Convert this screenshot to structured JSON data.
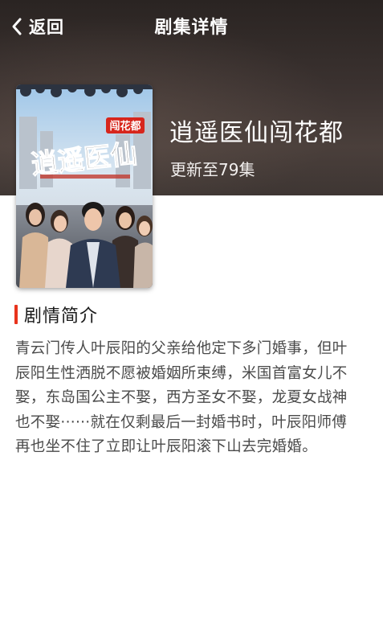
{
  "nav": {
    "back_label": "返回",
    "title": "剧集详情"
  },
  "drama": {
    "title": "逍遥医仙闯花都",
    "episode_status": "更新至79集",
    "poster_badge": "闯花都",
    "poster_calligraphy": "逍遥医仙"
  },
  "synopsis": {
    "header": "剧情简介",
    "text": "青云门传人叶辰阳的父亲给他定下多门婚事，但叶辰阳生性洒脱不愿被婚姻所束缚，米国首富女儿不娶，东岛国公主不娶，西方圣女不娶，龙夏女战神也不娶······就在仅剩最后一封婚书时，叶辰阳师傅再也坐不住了立即让叶辰阳滚下山去完婚婚。"
  },
  "colors": {
    "accent": "#e8331c",
    "hero_background": "#3b3230",
    "body_text": "#4a4a4a"
  },
  "icons": {
    "back": "chevron-left-icon"
  }
}
